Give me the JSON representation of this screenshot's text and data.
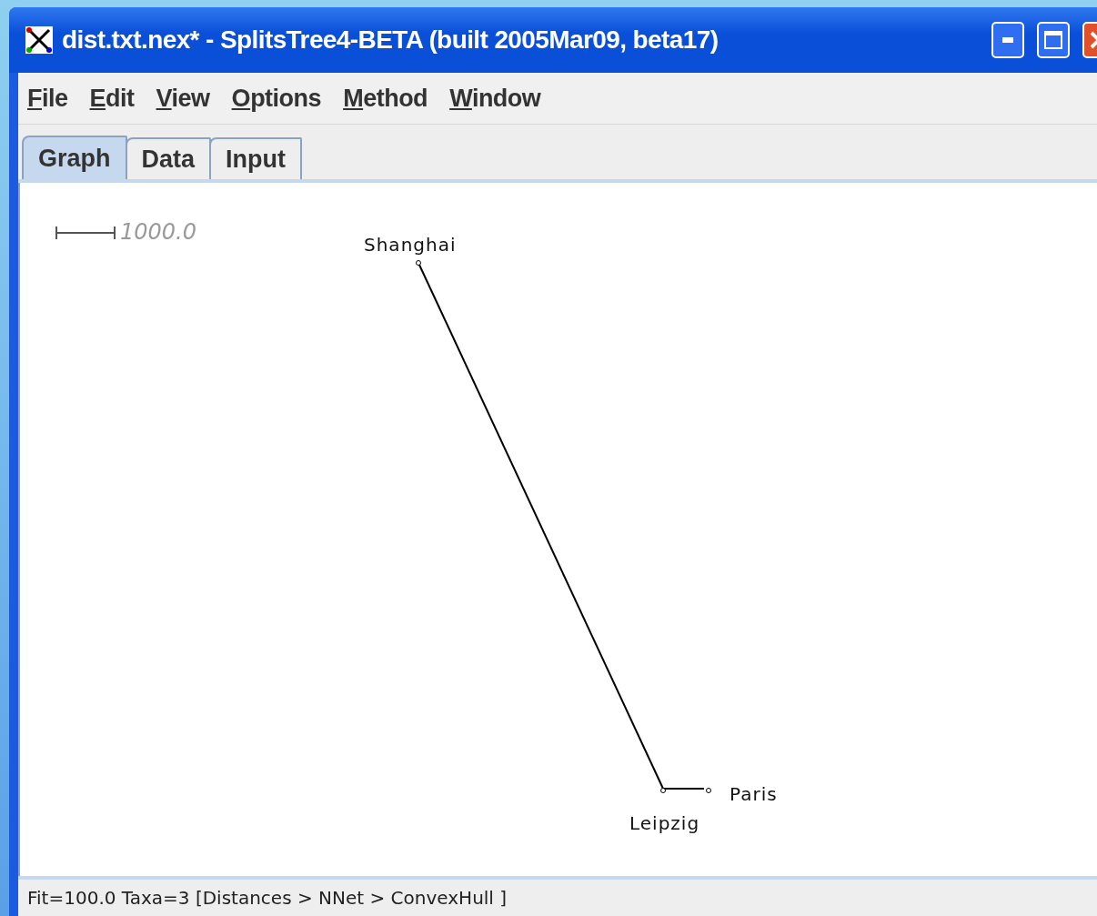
{
  "window": {
    "title": "dist.txt.nex* - SplitsTree4-BETA (built 2005Mar09, beta17)"
  },
  "menu": [
    "File",
    "Edit",
    "View",
    "Options",
    "Method",
    "Window"
  ],
  "tabs": [
    {
      "label": "Graph",
      "selected": true
    },
    {
      "label": "Data",
      "selected": false
    },
    {
      "label": "Input",
      "selected": false
    }
  ],
  "graph": {
    "scale_label": "1000.0",
    "taxa": [
      "Shanghai",
      "Leipzig",
      "Paris"
    ]
  },
  "status_bar": "Fit=100.0 Taxa=3 [Distances > NNet > ConvexHull ]"
}
